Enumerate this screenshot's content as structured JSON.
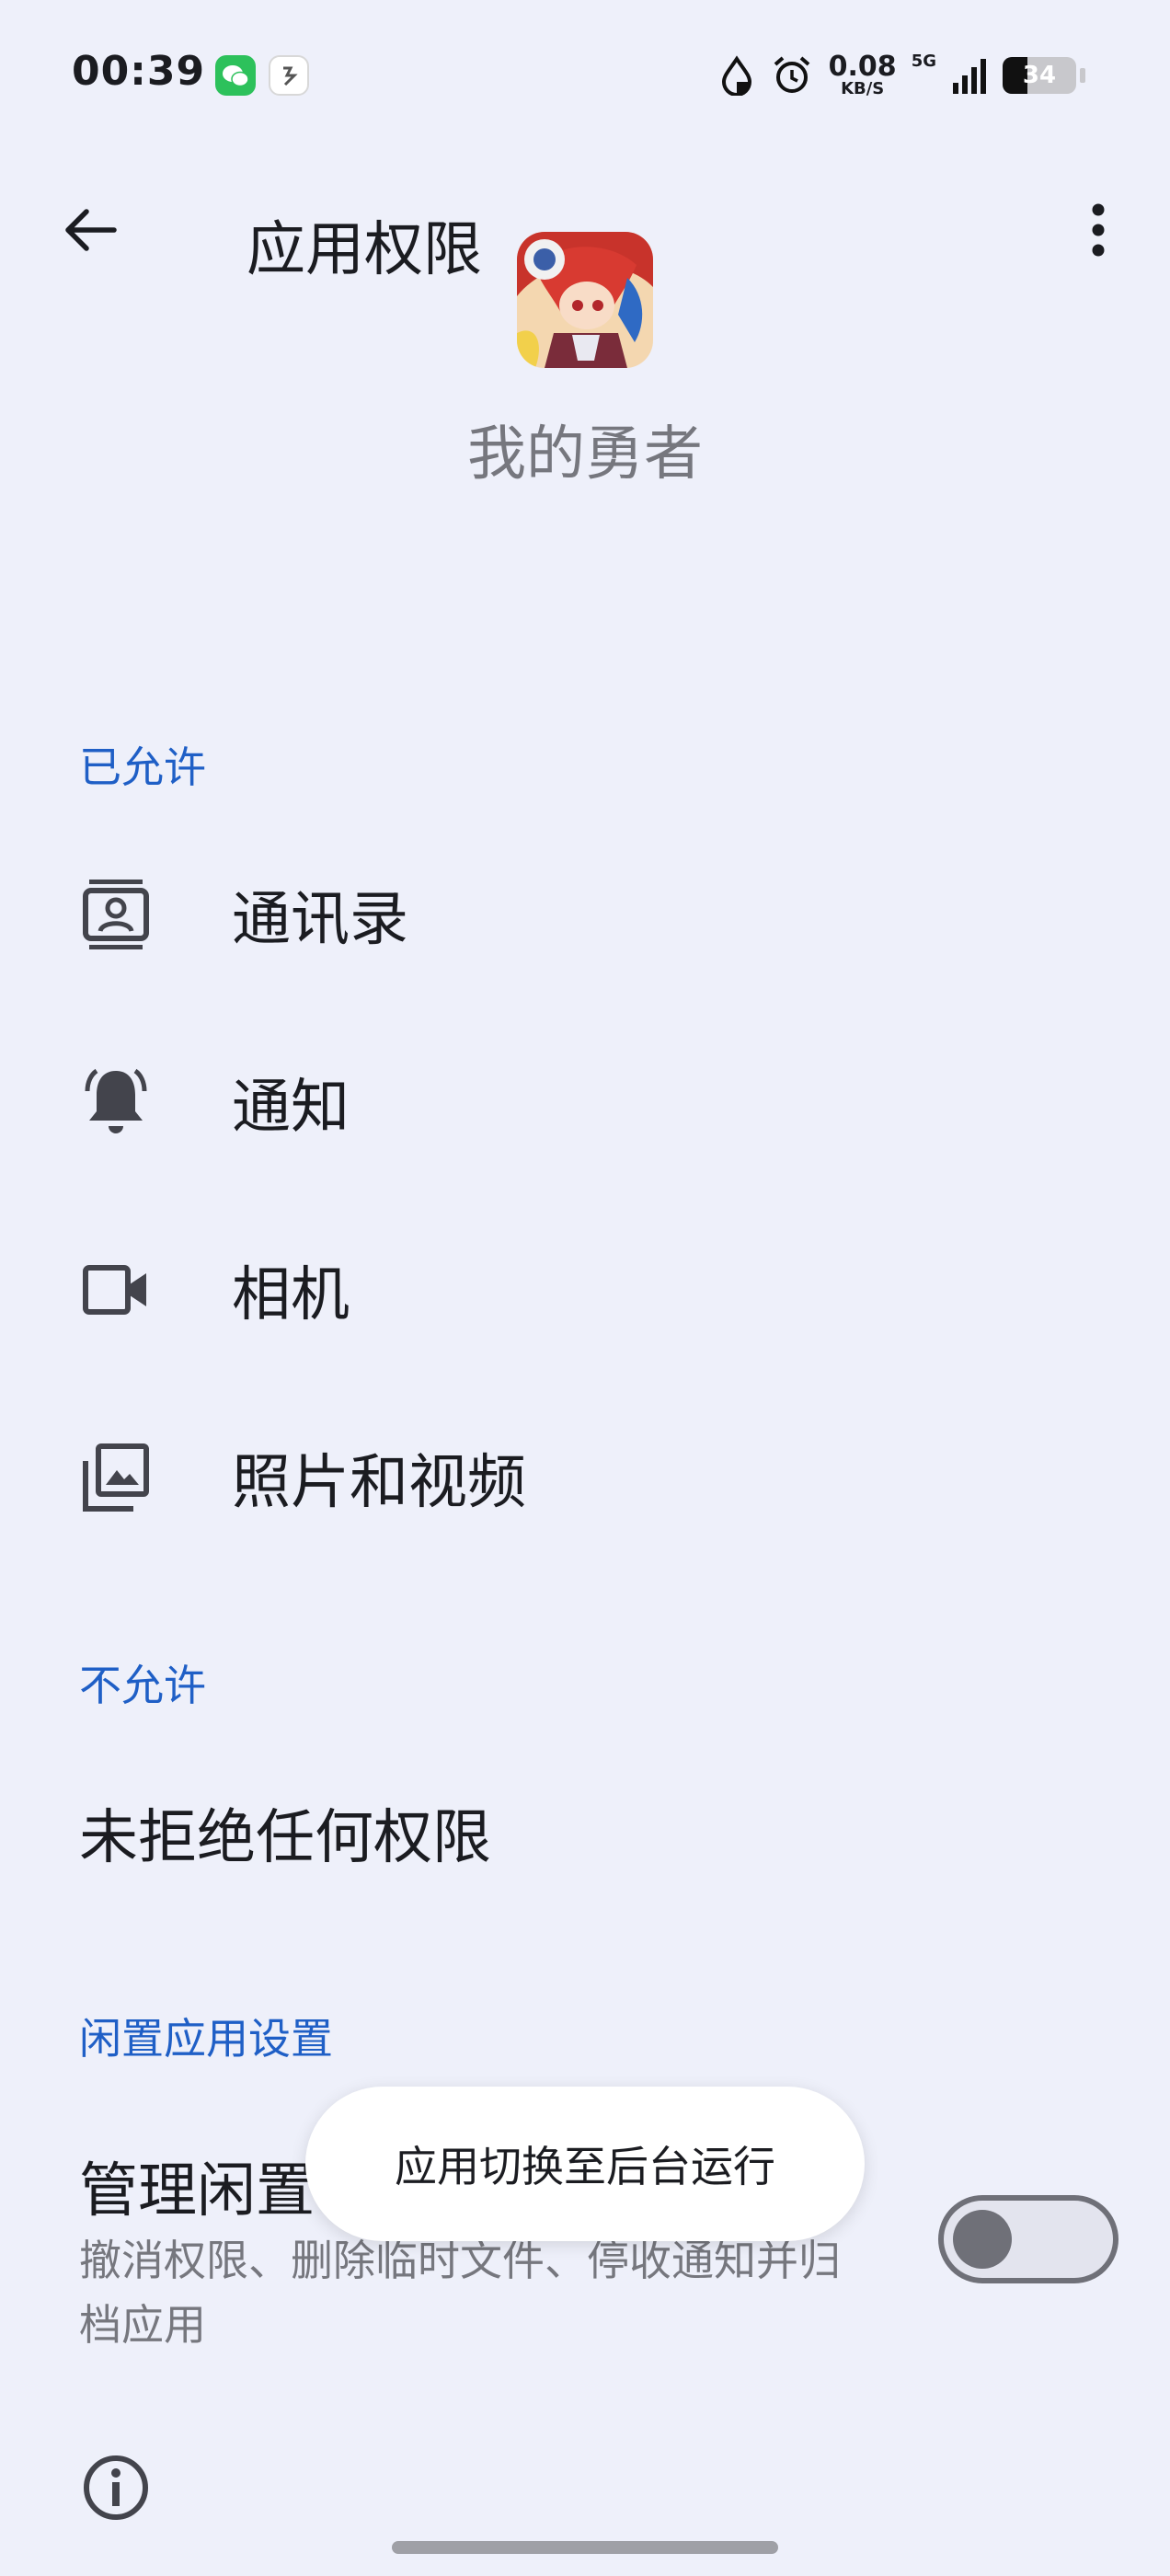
{
  "status_bar": {
    "time": "00:39",
    "speed_value": "0.08",
    "speed_unit": "KB/S",
    "network": "5G",
    "battery": "34",
    "battery_level": 0.34
  },
  "app_bar": {
    "title": "应用权限"
  },
  "app": {
    "name": "我的勇者"
  },
  "allowed": {
    "header": "已允许",
    "items": [
      {
        "label": "通讯录",
        "icon": "contacts-icon"
      },
      {
        "label": "通知",
        "icon": "bell-icon"
      },
      {
        "label": "相机",
        "icon": "camera-icon"
      },
      {
        "label": "照片和视频",
        "icon": "photos-icon"
      }
    ]
  },
  "denied": {
    "header": "不允许",
    "empty_text": "未拒绝任何权限"
  },
  "idle": {
    "header": "闲置应用设置",
    "title": "管理闲置",
    "subtitle": "撤消权限、删除临时文件、停收通知并归档应用",
    "toggle_on": false
  },
  "toast": {
    "text": "应用切换至后台运行"
  },
  "colors": {
    "background": "#eef0fa",
    "accent": "#1f5fc6",
    "toggle_off": "#6f7078"
  }
}
